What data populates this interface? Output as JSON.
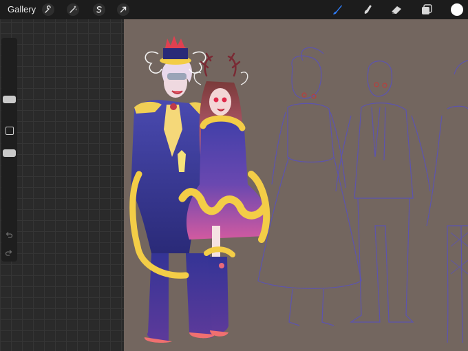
{
  "toolbar": {
    "gallery_label": "Gallery",
    "left_icons": [
      "wrench-icon",
      "magic-wand-icon",
      "selection-s-icon",
      "transform-arrow-icon"
    ],
    "right_icons": [
      "brush-icon",
      "smudge-icon",
      "eraser-icon",
      "layers-icon"
    ],
    "active_tool": "brush",
    "active_color": "#ffffff",
    "accent_color": "#2f7cf6"
  },
  "sidebar": {
    "brush_size_level": 0.28,
    "opacity_level": 0.55
  },
  "canvas": {
    "background_color": "#73665f",
    "sketch_color": "#5a52b8"
  }
}
